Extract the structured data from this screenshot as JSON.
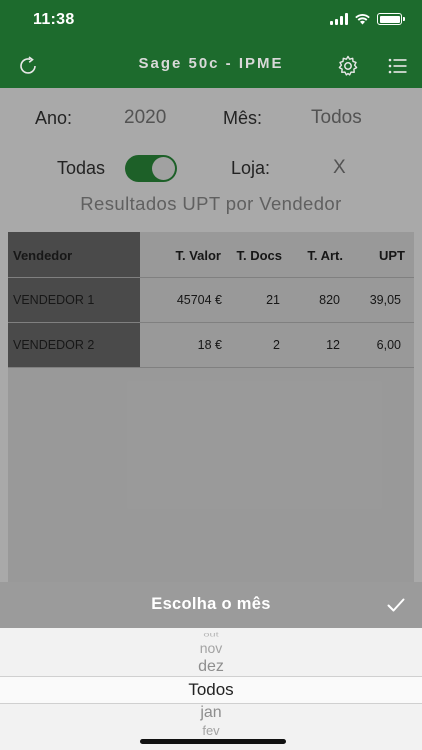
{
  "status": {
    "time": "11:38"
  },
  "header": {
    "title": "Sage 50c - IPME"
  },
  "filters": {
    "ano_label": "Ano:",
    "ano_value": "2020",
    "mes_label": "Mês:",
    "mes_value": "Todos",
    "todas_label": "Todas",
    "todas_on": true,
    "loja_label": "Loja:",
    "loja_value": "X"
  },
  "subtitle": "Resultados UPT por Vendedor",
  "table": {
    "headers": [
      "Vendedor",
      "T. Valor",
      "T. Docs",
      "T. Art.",
      "UPT"
    ],
    "rows": [
      [
        "VENDEDOR 1",
        "45704 €",
        "21",
        "820",
        "39,05"
      ],
      [
        "VENDEDOR 2",
        "18 €",
        "2",
        "12",
        "6,00"
      ]
    ]
  },
  "picker": {
    "title": "Escolha o mês",
    "items": [
      "out",
      "nov",
      "dez",
      "Todos",
      "jan",
      "fev"
    ],
    "selected": "Todos"
  },
  "colors": {
    "header": "#1d6b2d",
    "toggle": "#2a8a3a",
    "picker_bar": "#9b9b9b"
  }
}
